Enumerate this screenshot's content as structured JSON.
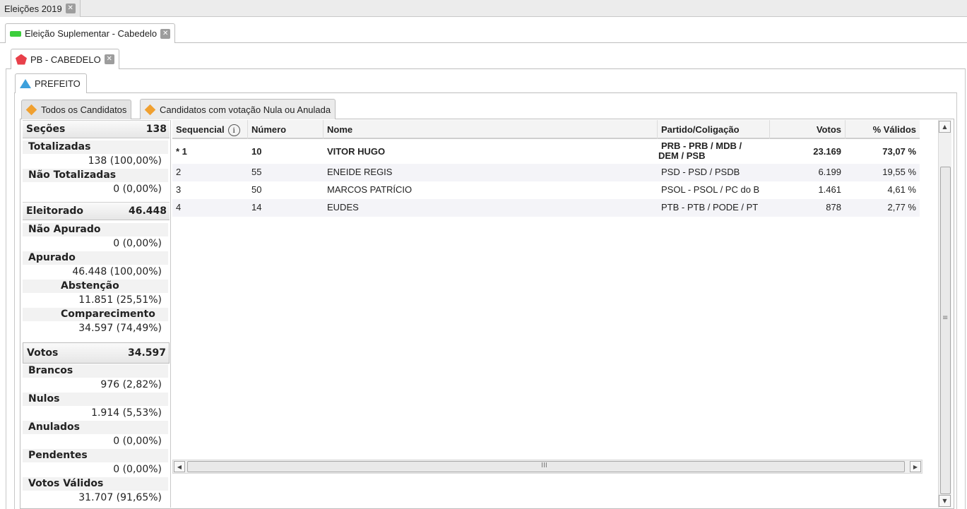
{
  "tabs": {
    "level1": "Eleições 2019",
    "level2": "Eleição Suplementar - Cabedelo",
    "level3": "PB - CABEDELO",
    "level4": "PREFEITO",
    "sub1": "Todos os Candidatos",
    "sub2": "Candidatos com votação Nula ou Anulada",
    "close_glyph": "✕"
  },
  "summary": {
    "secoes": {
      "label": "Seções",
      "value": "138"
    },
    "totalizadas": {
      "label": "Totalizadas",
      "value": "138 (100,00%)"
    },
    "nao_totalizadas": {
      "label": "Não Totalizadas",
      "value": "0 (0,00%)"
    },
    "eleitorado": {
      "label": "Eleitorado",
      "value": "46.448"
    },
    "nao_apurado": {
      "label": "Não Apurado",
      "value": "0 (0,00%)"
    },
    "apurado": {
      "label": "Apurado",
      "value": "46.448 (100,00%)"
    },
    "abstencao": {
      "label": "Abstenção",
      "value": "11.851 (25,51%)"
    },
    "comparecimento": {
      "label": "Comparecimento",
      "value": "34.597 (74,49%)"
    },
    "votos": {
      "label": "Votos",
      "value": "34.597"
    },
    "brancos": {
      "label": "Brancos",
      "value": "976 (2,82%)"
    },
    "nulos": {
      "label": "Nulos",
      "value": "1.914 (5,53%)"
    },
    "anulados": {
      "label": "Anulados",
      "value": "0 (0,00%)"
    },
    "pendentes": {
      "label": "Pendentes",
      "value": "0 (0,00%)"
    },
    "votos_validos": {
      "label": "Votos Válidos",
      "value": "31.707 (91,65%)"
    }
  },
  "grid": {
    "columns": {
      "sequencial": "Sequencial",
      "info_glyph": "i",
      "numero": "Número",
      "nome": "Nome",
      "partido": "Partido/Coligação",
      "votos": "Votos",
      "validos": "% Válidos"
    },
    "rows": [
      {
        "seq": "* 1",
        "numero": "10",
        "nome": "VITOR HUGO",
        "partido_l1": "PRB - PRB / MDB /",
        "partido_l2": "DEM / PSB",
        "votos": "23.169",
        "pct": "73,07 %"
      },
      {
        "seq": "2",
        "numero": "55",
        "nome": "ENEIDE REGIS",
        "partido": "PSD - PSD / PSDB",
        "votos": "6.199",
        "pct": "19,55 %"
      },
      {
        "seq": "3",
        "numero": "50",
        "nome": "MARCOS PATRÍCIO",
        "partido": "PSOL - PSOL / PC do B",
        "votos": "1.461",
        "pct": "4,61 %"
      },
      {
        "seq": "4",
        "numero": "14",
        "nome": "EUDES",
        "partido": "PTB - PTB / PODE / PT",
        "votos": "878",
        "pct": "2,77 %"
      }
    ]
  },
  "scroll": {
    "up": "▲",
    "down": "▼",
    "left": "◀",
    "right": "▶",
    "grip_v": "≡",
    "grip_h": "III"
  }
}
